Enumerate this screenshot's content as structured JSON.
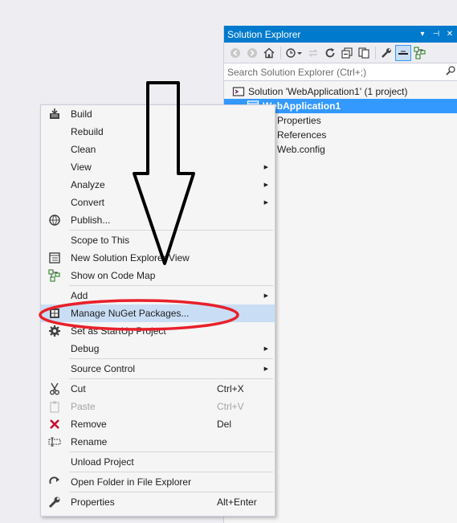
{
  "solution_explorer": {
    "title": "Solution Explorer",
    "title_controls": [
      "▾",
      "⊣",
      "✕"
    ],
    "search_placeholder": "Search Solution Explorer (Ctrl+;)",
    "tree": [
      {
        "label": "Solution 'WebApplication1' (1 project)",
        "indent": 0,
        "icon": "solution-icon",
        "selected": false
      },
      {
        "label": "WebApplication1",
        "indent": 1,
        "icon": "web-project-icon",
        "selected": true
      },
      {
        "label": "Properties",
        "indent": 2,
        "icon": "properties-folder-icon",
        "selected": false
      },
      {
        "label": "References",
        "indent": 2,
        "icon": "references-icon",
        "selected": false
      },
      {
        "label": "Web.config",
        "indent": 2,
        "icon": "config-file-icon",
        "selected": false
      }
    ]
  },
  "context_menu": {
    "items": [
      {
        "type": "item",
        "label": "Build",
        "icon": "build-icon"
      },
      {
        "type": "item",
        "label": "Rebuild"
      },
      {
        "type": "item",
        "label": "Clean"
      },
      {
        "type": "item",
        "label": "View",
        "submenu": true
      },
      {
        "type": "item",
        "label": "Analyze",
        "submenu": true
      },
      {
        "type": "item",
        "label": "Convert",
        "submenu": true
      },
      {
        "type": "item",
        "label": "Publish...",
        "icon": "publish-icon"
      },
      {
        "type": "separator"
      },
      {
        "type": "item",
        "label": "Scope to This"
      },
      {
        "type": "item",
        "label": "New Solution Explorer View",
        "icon": "new-view-icon"
      },
      {
        "type": "item",
        "label": "Show on Code Map",
        "icon": "code-map-icon"
      },
      {
        "type": "separator"
      },
      {
        "type": "item",
        "label": "Add",
        "submenu": true
      },
      {
        "type": "item",
        "label": "Manage NuGet Packages...",
        "icon": "nuget-icon",
        "highlighted": true
      },
      {
        "type": "item",
        "label": "Set as StartUp Project",
        "icon": "gear-icon"
      },
      {
        "type": "item",
        "label": "Debug",
        "submenu": true
      },
      {
        "type": "separator"
      },
      {
        "type": "item",
        "label": "Source Control",
        "submenu": true
      },
      {
        "type": "separator"
      },
      {
        "type": "item",
        "label": "Cut",
        "icon": "scissors-icon",
        "shortcut": "Ctrl+X"
      },
      {
        "type": "item",
        "label": "Paste",
        "icon": "paste-icon",
        "shortcut": "Ctrl+V",
        "disabled": true
      },
      {
        "type": "item",
        "label": "Remove",
        "icon": "remove-icon",
        "shortcut": "Del"
      },
      {
        "type": "item",
        "label": "Rename",
        "icon": "rename-icon"
      },
      {
        "type": "separator"
      },
      {
        "type": "item",
        "label": "Unload Project"
      },
      {
        "type": "separator"
      },
      {
        "type": "item",
        "label": "Open Folder in File Explorer",
        "icon": "refresh-arrow-icon"
      },
      {
        "type": "separator"
      },
      {
        "type": "item",
        "label": "Properties",
        "icon": "wrench-icon",
        "shortcut": "Alt+Enter"
      }
    ]
  },
  "annotations": {
    "arrow_color": "#000000",
    "ellipse_color": "#e8202b"
  },
  "colors": {
    "accent": "#007acc",
    "selection": "#3399ff",
    "hover": "#c9def5"
  }
}
